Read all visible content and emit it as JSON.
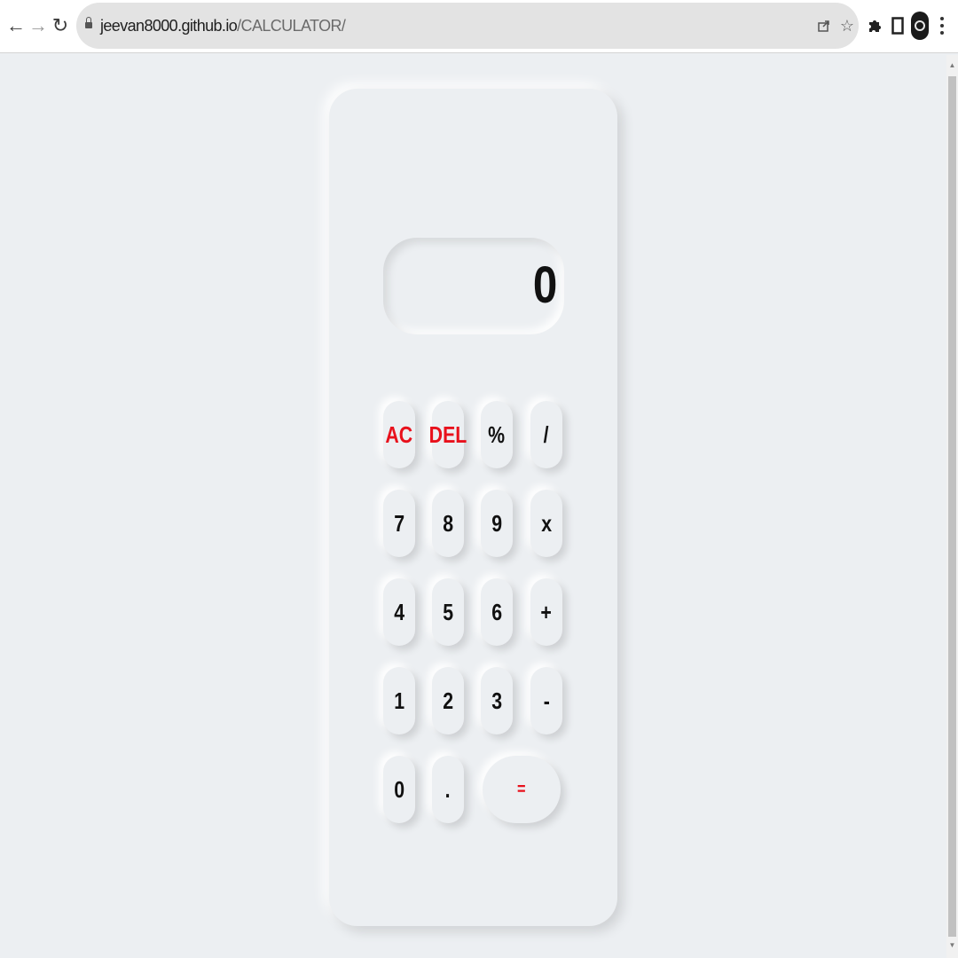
{
  "browser": {
    "url_host": "jeevan8000.github.io",
    "url_path": "/CALCULATOR/",
    "icons": [
      "back-arrow-icon",
      "forward-arrow-icon",
      "reload-icon",
      "lock-icon",
      "share-icon",
      "star-icon",
      "extensions-puzzle-icon",
      "side-panel-icon",
      "profile-avatar-icon",
      "kebab-menu-icon"
    ]
  },
  "calculator": {
    "display": "0",
    "keys": {
      "ac": "AC",
      "del": "DEL",
      "percent": "%",
      "divide": "/",
      "seven": "7",
      "eight": "8",
      "nine": "9",
      "multiply": "x",
      "four": "4",
      "five": "5",
      "six": "6",
      "plus": "+",
      "one": "1",
      "two": "2",
      "three": "3",
      "minus": "-",
      "zero": "0",
      "dot": ".",
      "equals": "="
    },
    "accent_color": "#e8111c",
    "background_color": "#eceff2"
  }
}
